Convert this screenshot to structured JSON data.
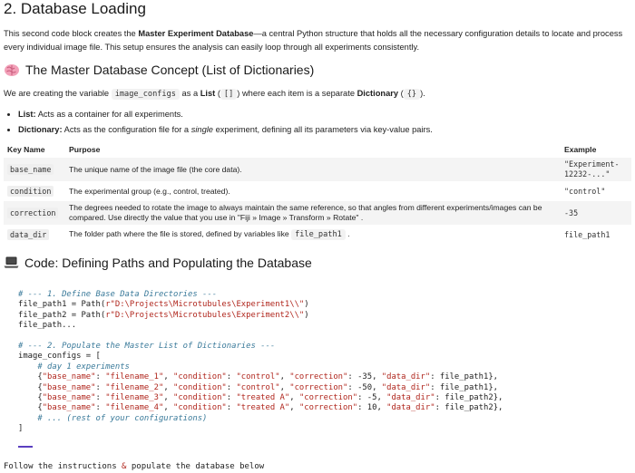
{
  "heading": "2. Database Loading",
  "intro": {
    "a": "This second code block creates the ",
    "b": "Master Experiment Database",
    "c": "—a central Python structure that holds all the necessary configuration details to locate and process every individual image file. This setup ensures the analysis can easily loop through all experiments consistently."
  },
  "concept": {
    "icon": "brain-icon",
    "title": "The Master Database Concept (List of Dictionaries)"
  },
  "desc": {
    "a": "We are creating the variable ",
    "var": "image_configs",
    "b": " as a ",
    "list": "List",
    "c": " (",
    "brackets": "[]",
    "d": ") where each item is a separate ",
    "dict": "Dictionary",
    "e": " (",
    "braces": "{}",
    "f": ")."
  },
  "bullets": [
    {
      "term": "List:",
      "text": " Acts as a container for all experiments."
    },
    {
      "term": "Dictionary:",
      "pre": " Acts as the configuration file for a ",
      "em": "single",
      "post": " experiment, defining all its parameters via key-value pairs."
    }
  ],
  "table": {
    "headers": [
      "Key Name",
      "Purpose",
      "Example"
    ],
    "rows": [
      {
        "key": "base_name",
        "purpose": "The unique name of the image file (the core data).",
        "example": "\"Experiment-12232-...\""
      },
      {
        "key": "condition",
        "purpose": "The experimental group (e.g., control, treated).",
        "example": "\"control\""
      },
      {
        "key": "correction",
        "purpose": "The degrees needed to rotate the image to always maintain the same reference, so that angles from different experiments/images can be compared. Use directly the value that you use in \"Fiji » Image » Transform » Rotate\" .",
        "example": "-35"
      },
      {
        "key": "data_dir",
        "purpose_a": "The folder path where the file is stored, defined by variables like ",
        "purpose_code": "file_path1",
        "purpose_b": " .",
        "example": "file_path1"
      }
    ]
  },
  "code_section": {
    "icon": "laptop-icon",
    "title": "Code: Defining Paths and Populating the Database"
  },
  "code": {
    "c1": "# --- 1. Define Base Data Directories ---",
    "l2a": "file_path1 = Path(",
    "l2s": "r\"D:\\Projects\\Microtubules\\Experiment1\\\\\"",
    "l3a": "file_path2 = Path(",
    "l3s": "r\"D:\\Projects\\Microtubules\\Experiment2\\\\\"",
    "l4": "file_path...",
    "c2": "# --- 2. Populate the Master List of Dictionaries ---",
    "l6": "image_configs = [",
    "c3": "    # day 1 experiments",
    "rows": [
      {
        "k1": "\"base_name\"",
        "v1": "\"filename_1\"",
        "k2": "\"condition\"",
        "v2": "\"control\"",
        "k3": "\"correction\"",
        "v3": "-35",
        "k4": "\"data_dir\"",
        "v4": "file_path1"
      },
      {
        "k1": "\"base_name\"",
        "v1": "\"filename_2\"",
        "k2": "\"condition\"",
        "v2": "\"control\"",
        "k3": "\"correction\"",
        "v3": "-50",
        "k4": "\"data_dir\"",
        "v4": "file_path1"
      },
      {
        "k1": "\"base_name\"",
        "v1": "\"filename_3\"",
        "k2": "\"condition\"",
        "v2": "\"treated A\"",
        "k3": "\"correction\"",
        "v3": "-5",
        "k4": "\"data_dir\"",
        "v4": "file_path2"
      },
      {
        "k1": "\"base_name\"",
        "v1": "\"filename_4\"",
        "k2": "\"condition\"",
        "v2": "\"treated A\"",
        "k3": "\"correction\"",
        "v3": "10",
        "k4": "\"data_dir\"",
        "v4": "file_path2"
      }
    ],
    "c4": "    # ... (rest of your configurations)",
    "close": "]"
  },
  "follow": {
    "a": "Follow the instructions ",
    "amp": "&",
    "b": " populate the database below"
  }
}
